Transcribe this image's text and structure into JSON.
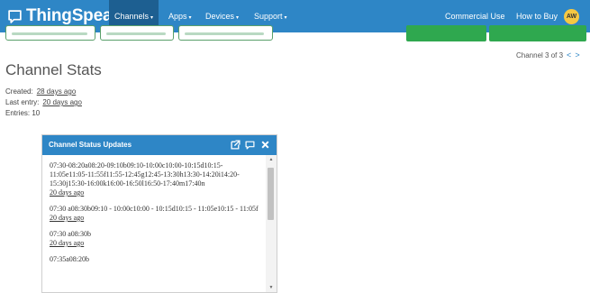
{
  "navbar": {
    "brand": "ThingSpeak",
    "brand_tm": "™",
    "items": [
      {
        "label": "Channels",
        "caret": "▾"
      },
      {
        "label": "Apps",
        "caret": "▾"
      },
      {
        "label": "Devices",
        "caret": "▾"
      },
      {
        "label": "Support",
        "caret": "▾"
      }
    ],
    "right_links": [
      "Commercial Use",
      "How to Buy"
    ],
    "avatar_initials": "AW",
    "colors": {
      "bar": "#2e86c6",
      "active": "#1d5f91",
      "avatar": "#f5c842"
    }
  },
  "pager": {
    "label": "Channel 3 of 3",
    "prev": "<",
    "next": ">"
  },
  "page_title": "Channel Stats",
  "stats": {
    "created_label": "Created:",
    "created_value": "28 days ago",
    "last_entry_label": "Last entry:",
    "last_entry_value": "20 days ago",
    "entries": "Entries: 10"
  },
  "status_panel": {
    "title": "Channel Status Updates",
    "icons": [
      "external-link-icon",
      "comment-icon",
      "close-icon"
    ],
    "updates": [
      {
        "text": "07:30-08:20a08:20-09:10b09:10-10:00c10:00-10:15d10:15-11:05e11:05-11:55f11:55-12:45g12:45-13:30h13:30-14:20i14:20-15:30j15:30-16:00k16:00-16:50l16:50-17:40m17:40n",
        "ago": "20 days ago"
      },
      {
        "text": "07:30 a08:30b09:10 - 10:00c10:00 - 10:15d10:15 - 11:05e10:15 - 11:05f",
        "ago": "20 days ago"
      },
      {
        "text": "07:30 a08:30b",
        "ago": "20 days ago"
      },
      {
        "text": "07:35a08:20b",
        "ago": ""
      }
    ]
  }
}
